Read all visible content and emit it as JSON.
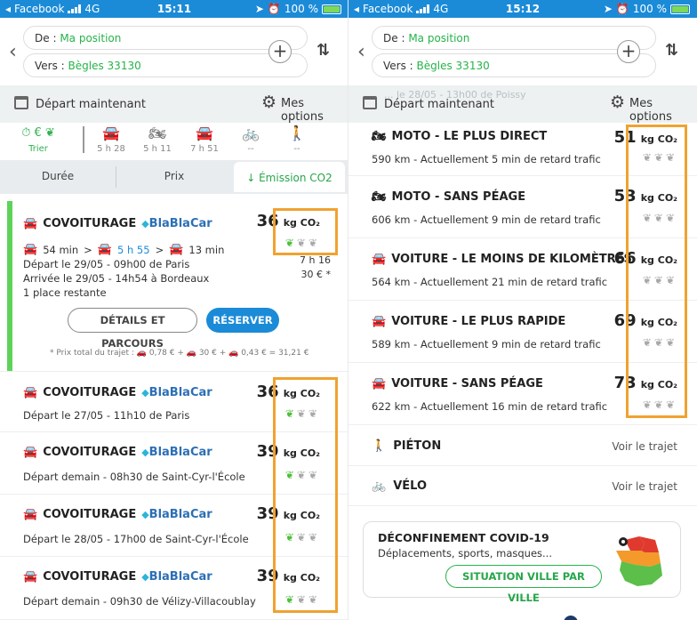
{
  "colors": {
    "statusbar": "#1b8bd8",
    "accent_green": "#26b34a",
    "reserve_blue": "#1b8bd8",
    "highlight": "#f0a230"
  },
  "left": {
    "status": {
      "carrier": "Facebook",
      "network": "4G",
      "time": "15:11",
      "battery": "100 %"
    },
    "from": {
      "label": "De :",
      "value": "Ma position"
    },
    "to": {
      "label": "Vers :",
      "value": "Bègles 33130"
    },
    "departure_label": "Départ maintenant",
    "options_label": "Mes options",
    "modes": [
      {
        "icon": "sort-icon",
        "label": "Trier"
      },
      {
        "icon": "car-icon",
        "label": "5 h 28"
      },
      {
        "icon": "motorbike-icon",
        "label": "5 h 11"
      },
      {
        "icon": "car-icon",
        "label": "7 h 51"
      },
      {
        "icon": "bike-icon",
        "label": "--"
      },
      {
        "icon": "walker-icon",
        "label": "--"
      }
    ],
    "tabs": [
      "Durée",
      "Prix",
      "↓ Émission CO2"
    ],
    "first_card": {
      "title": "COVOITURAGE",
      "brand": "BlaBlaCar",
      "leg1": "54 min",
      "leg2": "5 h 55",
      "leg3": "13 min",
      "depart": "Départ le 29/05 - 09h00 de Paris",
      "arrive": "Arrivée le 29/05 - 14h54 à Bordeaux",
      "places": "1 place restante",
      "duration": "7 h 16",
      "price": "30 € *",
      "co2": "36",
      "details_label": "DÉTAILS ET PARCOURS",
      "reserve_label": "RÉSERVER",
      "price_note": "* Prix total du trajet : 🚗 0,78 € + 🚗 30 € + 🚗 0,43 € = 31,21 €"
    },
    "cards": [
      {
        "title": "COVOITURAGE",
        "brand": "BlaBlaCar",
        "sub": "Départ le 27/05 - 11h10 de Paris",
        "co2": "36"
      },
      {
        "title": "COVOITURAGE",
        "brand": "BlaBlaCar",
        "sub": "Départ demain - 08h30 de Saint-Cyr-l'École",
        "co2": "39"
      },
      {
        "title": "COVOITURAGE",
        "brand": "BlaBlaCar",
        "sub": "Départ le 28/05 - 17h00 de Saint-Cyr-l'École",
        "co2": "39"
      },
      {
        "title": "COVOITURAGE",
        "brand": "BlaBlaCar",
        "sub": "Départ demain - 09h30 de Vélizy-Villacoublay",
        "co2": "39"
      }
    ],
    "co2_unit": "kg CO₂"
  },
  "right": {
    "status": {
      "carrier": "Facebook",
      "network": "4G",
      "time": "15:12",
      "battery": "100 %"
    },
    "from": {
      "label": "De :",
      "value": "Ma position"
    },
    "to": {
      "label": "Vers :",
      "value": "Bègles 33130"
    },
    "departure_label": "Départ maintenant",
    "ghost_text": "... le 28/05 - 13h00 de Poissy",
    "options_label": "Mes options",
    "routes": [
      {
        "icon": "motorbike-icon",
        "title": "MOTO - LE PLUS DIRECT",
        "sub": "590 km - Actuellement 5 min de retard trafic",
        "co2": "51"
      },
      {
        "icon": "motorbike-icon",
        "title": "MOTO - SANS PÉAGE",
        "sub": "606 km - Actuellement 9 min de retard trafic",
        "co2": "53"
      },
      {
        "icon": "car-icon",
        "title": "VOITURE - LE MOINS DE KILOMÈTRES",
        "sub": "564 km - Actuellement 21 min de retard trafic",
        "co2": "66"
      },
      {
        "icon": "car-icon",
        "title": "VOITURE - LE PLUS RAPIDE",
        "sub": "589 km - Actuellement 9 min de retard trafic",
        "co2": "69"
      },
      {
        "icon": "car-icon",
        "title": "VOITURE - SANS PÉAGE",
        "sub": "622 km - Actuellement 16 min de retard trafic",
        "co2": "73"
      }
    ],
    "co2_unit": "kg CO₂",
    "pieton": {
      "title": "PIÉTON",
      "link": "Voir le trajet"
    },
    "velo": {
      "title": "VÉLO",
      "link": "Voir le trajet"
    },
    "covid": {
      "title": "DÉCONFINEMENT COVID-19",
      "sub": "Déplacements, sports, masques...",
      "button": "SITUATION VILLE PAR VILLE"
    }
  }
}
